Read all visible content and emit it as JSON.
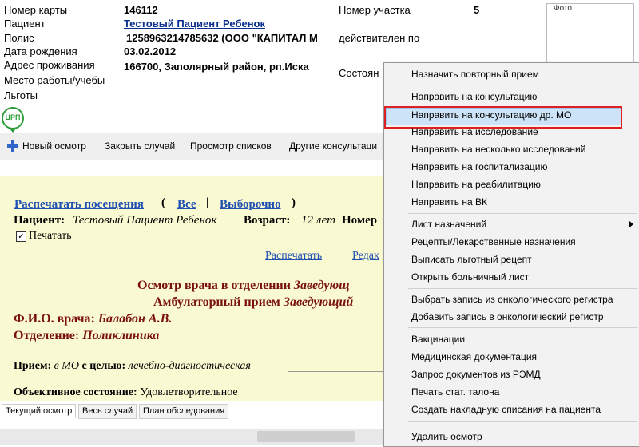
{
  "patient": {
    "card_label": "Номер карты",
    "card_value": "146112",
    "patient_label": "Пациент",
    "patient_value": "Тестовый Пациент Ребенок",
    "policy_label": "Полис",
    "policy_value": "125896321478563​2 (ООО \"КАПИТАЛ М",
    "dob_label": "Дата рождения",
    "dob_value": "03.02.2012",
    "address_label": "Адрес проживания",
    "address_value": "166700, Заполярный район, рп.Иска",
    "work_label": "Место работы/учебы",
    "benefits_label": "Льготы",
    "district_label": "Номер участка",
    "district_value": "5",
    "valid_label": "действителен по",
    "state_label": "Состоян",
    "photo_label": "Фото",
    "logo_text": "ЦРП"
  },
  "toolbar": {
    "new_exam": "Новый осмотр",
    "close_case": "Закрыть случай",
    "view_lists": "Просмотр списков",
    "other_consults": "Другие консультаци"
  },
  "content": {
    "print_visits": "Распечатать посещения",
    "paren_open": "(",
    "all": "Все",
    "pipe": "|",
    "selective": "Выборочно",
    "paren_close": ")",
    "patient_label": "Пациент:",
    "patient_name": "Тестовый Пациент Ребенок",
    "age_label": "Возраст:",
    "age_value": "12 лет",
    "number_label": "Номер",
    "print_label": "Печатать",
    "print_link": "Распечатать",
    "edit_link": "Редак",
    "exam_title_a": "Осмотр врача в отделении",
    "exam_title_b": "Заведующ",
    "amb_title_a": "Амбулаторный прием",
    "amb_title_b": "Заведующий",
    "doctor_label": "Ф.И.О. врача:",
    "doctor_value": "Балабон А.В.",
    "dept_label": "Отделение:",
    "dept_value": "Поликлиника",
    "reception_label": "Прием:",
    "reception_place": "в МО",
    "purpose_label": "с целью:",
    "purpose_value": "лечебно-диагностическая",
    "objective_label": "Объективное состояние:",
    "objective_value": "Удовлетворительное"
  },
  "tabs": [
    "Текущий осмотр",
    "Весь случай",
    "План обследования"
  ],
  "menu": {
    "items": [
      "Назначить повторный прием",
      "Направить на консультацию",
      "Направить на консультацию др. МО",
      "Направить на исследование",
      "Направить на несколько исследований",
      "Направить на госпитализацию",
      "Направить на реабилитацию",
      "Направить на ВК",
      "Лист назначений",
      "Рецепты/Лекарственные назначения",
      "Выписать льготный рецепт",
      "Открыть больничный лист",
      "Выбрать запись из онкологического регистра",
      "Добавить запись в онкологический регистр",
      "Вакцинации",
      "Медицинская документация",
      "Запрос документов из РЭМД",
      "Печать стат. талона",
      "Создать накладную списания на пациента",
      "Удалить осмотр"
    ]
  },
  "colors": {
    "highlight_border": "#e02020",
    "link": "#1f4fb0",
    "title_dark_red": "#7a1111",
    "content_bg": "#fafad2"
  }
}
